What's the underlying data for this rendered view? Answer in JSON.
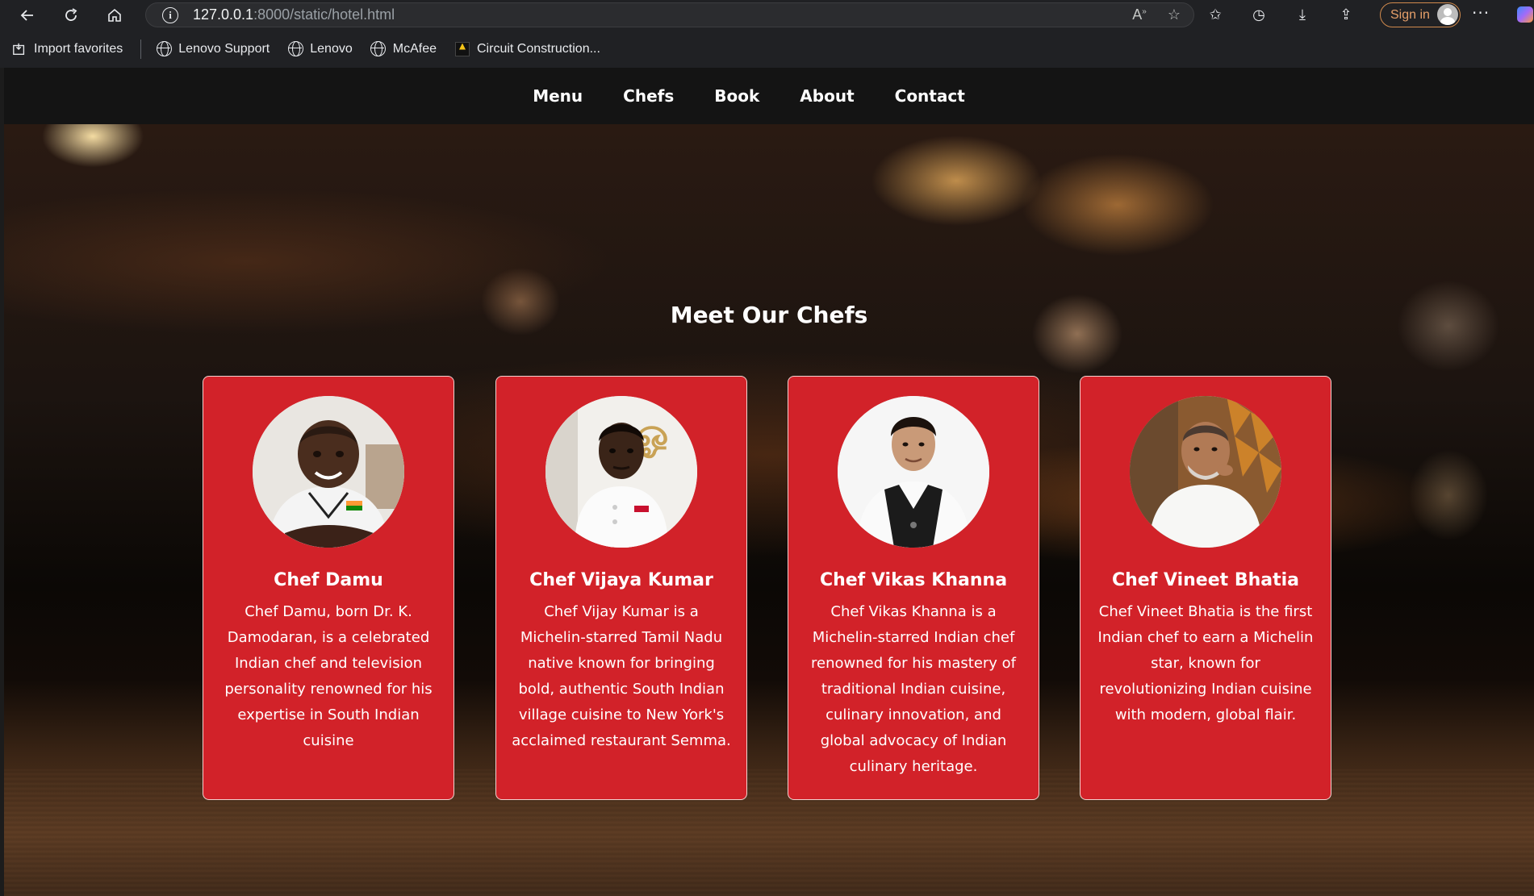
{
  "browser": {
    "url_host": "127.0.0.1",
    "url_rest": ":8000/static/hotel.html",
    "sign_in_label": "Sign in",
    "bookmarks": [
      {
        "label": "Import favorites"
      },
      {
        "label": "Lenovo Support"
      },
      {
        "label": "Lenovo"
      },
      {
        "label": "McAfee"
      },
      {
        "label": "Circuit Construction..."
      }
    ]
  },
  "site_nav": {
    "items": [
      {
        "label": "Menu"
      },
      {
        "label": "Chefs"
      },
      {
        "label": "Book"
      },
      {
        "label": "About"
      },
      {
        "label": "Contact"
      }
    ]
  },
  "chefs_section": {
    "title": "Meet Our Chefs",
    "chefs": [
      {
        "name": "Chef Damu",
        "bio": "Chef Damu, born Dr. K. Damodaran, is a celebrated Indian chef and television personality renowned for his expertise in South Indian cuisine"
      },
      {
        "name": "Chef Vijaya Kumar",
        "bio": "Chef Vijay Kumar is a Michelin-starred Tamil Nadu native known for bringing bold, authentic South Indian village cuisine to New York's acclaimed restaurant Semma."
      },
      {
        "name": "Chef Vikas Khanna",
        "bio": "Chef Vikas Khanna is a Michelin-starred Indian chef renowned for his mastery of traditional Indian cuisine, culinary innovation, and global advocacy of Indian culinary heritage."
      },
      {
        "name": "Chef Vineet Bhatia",
        "bio": "Chef Vineet Bhatia is the first Indian chef to earn a Michelin star, known for revolutionizing Indian cuisine with modern, global flair."
      }
    ]
  },
  "colors": {
    "card_red": "#d22229",
    "nav_bg": "#141414",
    "signin_accent": "#d08a4d"
  }
}
